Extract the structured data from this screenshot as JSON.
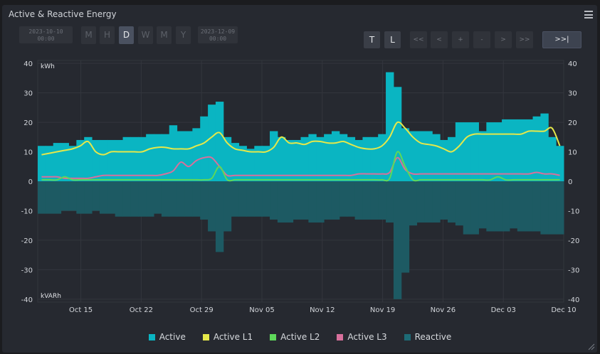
{
  "panel": {
    "title": "Active & Reactive Energy"
  },
  "toolbar": {
    "start_date": "2023-10-10",
    "start_time": "00:00",
    "end_date": "2023-12-09",
    "end_time": "00:00",
    "range_buttons": [
      "M",
      "H",
      "D",
      "W",
      "M",
      "Y"
    ],
    "active_range": "D",
    "view_buttons": [
      "T",
      "L"
    ],
    "nav_buttons": [
      "<<",
      "<",
      "+",
      "-",
      ">",
      ">>"
    ],
    "go_label": ">>|"
  },
  "colors": {
    "active": "#0ab5c2",
    "active_l1": "#e5e84a",
    "active_l2": "#5ed85a",
    "active_l3": "#d8709c",
    "reactive": "#1d5a63",
    "grid": "#33363d",
    "panel_bg": "#262930"
  },
  "chart_data": {
    "type": "bar",
    "x_start": "2023-10-10",
    "x_end": "2023-12-10",
    "x_tick_labels": [
      "Oct 15",
      "Oct 22",
      "Oct 29",
      "Nov 05",
      "Nov 12",
      "Nov 19",
      "Nov 26",
      "Dec 03",
      "Dec 10"
    ],
    "y_ticks": [
      40,
      30,
      20,
      10,
      0,
      -10,
      -20,
      -30,
      -40
    ],
    "ylim": [
      -41,
      41
    ],
    "ylabel_top": "kWh",
    "ylabel_bottom": "kVARh",
    "series": [
      {
        "name": "Active",
        "kind": "bar",
        "values": [
          12,
          12,
          13,
          13,
          12,
          14,
          15,
          14,
          14,
          14,
          14,
          15,
          15,
          15,
          16,
          16,
          16,
          19,
          17,
          17,
          18,
          22,
          26,
          27,
          15,
          13,
          12,
          11,
          12,
          12,
          17,
          15,
          14,
          14,
          15,
          16,
          15,
          16,
          17,
          16,
          15,
          14,
          15,
          15,
          16,
          37,
          32,
          18,
          17,
          17,
          17,
          16,
          14,
          15,
          20,
          20,
          20,
          17,
          20,
          20,
          21,
          21,
          21,
          21,
          22,
          23,
          15,
          12
        ]
      },
      {
        "name": "Active L1",
        "kind": "line",
        "values": [
          9,
          9.5,
          10,
          10.5,
          11,
          12,
          13.5,
          10,
          9,
          10,
          10,
          10,
          10,
          10,
          11,
          11.5,
          11.5,
          11,
          11,
          11,
          12,
          13,
          15,
          16.5,
          13,
          11,
          10.5,
          10,
          10,
          10,
          11.5,
          15,
          13,
          13,
          12.5,
          13.5,
          13.5,
          13,
          13,
          13.5,
          12.5,
          11.5,
          11,
          11,
          12,
          15,
          20,
          18,
          15,
          13,
          12.5,
          12,
          11,
          10,
          12,
          15,
          16,
          16,
          16,
          16,
          16,
          16,
          16,
          17,
          17,
          17,
          18,
          12
        ]
      },
      {
        "name": "Active L2",
        "kind": "line",
        "values": [
          0.5,
          0.5,
          0.5,
          1.5,
          0.5,
          0.5,
          0.5,
          0.5,
          0.5,
          0.5,
          0.5,
          0.5,
          0.5,
          0.5,
          0.5,
          0.5,
          0.5,
          0.5,
          0.5,
          0.5,
          0.5,
          0.5,
          1,
          5,
          0.5,
          0.5,
          0.5,
          0.5,
          0.5,
          0.5,
          0.5,
          0.5,
          0.5,
          0.5,
          0.5,
          0.5,
          0.5,
          0.5,
          0.5,
          0.5,
          0.5,
          0.5,
          0.5,
          0.5,
          0.5,
          1,
          10,
          5,
          0.5,
          0.5,
          0.5,
          0.5,
          0.5,
          0.5,
          0.5,
          0.5,
          0.5,
          0.5,
          0.5,
          1.5,
          0.5,
          0.5,
          0.5,
          0.5,
          0.5,
          0.5,
          0.5,
          0.5
        ]
      },
      {
        "name": "Active L3",
        "kind": "line",
        "values": [
          1.5,
          1.5,
          1.5,
          1,
          1,
          1,
          1,
          1.5,
          2,
          2,
          2,
          2,
          2,
          2,
          2,
          2,
          2.5,
          3.5,
          6.5,
          5,
          7,
          8,
          8,
          5,
          2,
          2,
          2,
          2,
          2,
          2,
          2,
          2,
          2,
          2,
          2,
          2,
          2,
          2,
          2,
          2,
          2,
          2.5,
          2.5,
          2.5,
          2.5,
          3,
          8,
          4,
          2.5,
          2.5,
          2.5,
          2.5,
          2.5,
          2.5,
          2.5,
          2.5,
          2.5,
          2.5,
          2.5,
          2.5,
          2.5,
          2.5,
          2.5,
          2.5,
          3,
          2.5,
          2.5,
          2
        ]
      },
      {
        "name": "Reactive",
        "kind": "bar",
        "values": [
          -11,
          -11,
          -11,
          -10,
          -10,
          -11,
          -11,
          -10,
          -11,
          -11,
          -12,
          -12,
          -12,
          -12,
          -12,
          -11,
          -12,
          -12,
          -12,
          -12,
          -12,
          -13,
          -17,
          -24,
          -17,
          -12,
          -12,
          -12,
          -12,
          -12,
          -13,
          -14,
          -14,
          -13,
          -13,
          -14,
          -14,
          -13,
          -13,
          -12,
          -12,
          -13,
          -13,
          -13,
          -13,
          -14,
          -40,
          -31,
          -15,
          -14,
          -14,
          -14,
          -13,
          -14,
          -15,
          -18,
          -18,
          -16,
          -17,
          -17,
          -17,
          -16,
          -17,
          -17,
          -17,
          -18,
          -18,
          -18
        ]
      }
    ]
  }
}
